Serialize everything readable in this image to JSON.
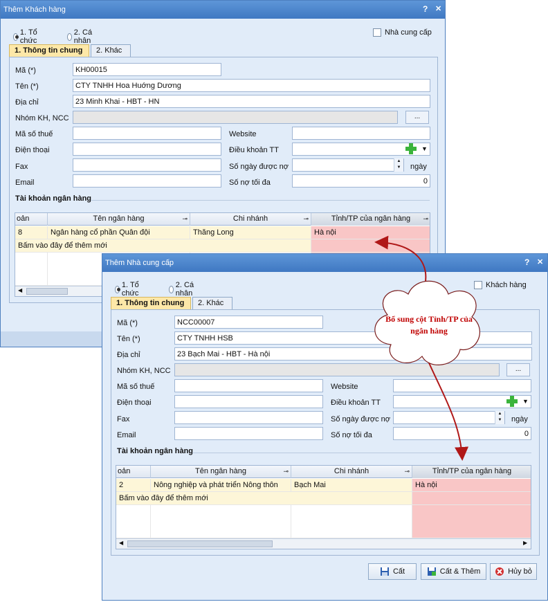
{
  "win1": {
    "title": "Thêm Khách hàng",
    "help": "?",
    "close": "✕",
    "radio_org": "1. Tổ chức",
    "radio_person": "2. Cá nhân",
    "check_label": "Nhà cung cấp",
    "tab_general": "1. Thông tin chung",
    "tab_other": "2. Khác",
    "labels": {
      "ma": "Mã (*)",
      "ten": "Tên (*)",
      "diachi": "Địa chỉ",
      "nhom": "Nhóm KH, NCC",
      "mst": "Mã số thuế",
      "dt": "Điện thoại",
      "fax": "Fax",
      "email": "Email",
      "web": "Website",
      "dktt": "Điều khoản TT",
      "sndn": "Số ngày được nợ",
      "sntd": "Số nợ tối đa",
      "ngay": "ngày"
    },
    "values": {
      "ma": "KH00015",
      "ten": "CTY TNHH Hoa Huớng Dương",
      "diachi": "23 Minh Khai - HBT - HN",
      "sntd": "0",
      "dots": "..."
    },
    "bank_section": "Tài khoản ngân hàng",
    "grid": {
      "headers": [
        "oản",
        "Tên ngân hàng",
        "Chi nhánh",
        "Tỉnh/TP của ngân hàng"
      ],
      "row": [
        "8",
        "Ngân hàng cổ phần Quân đội",
        "Thăng Long",
        "Hà nội"
      ],
      "add_row": "Bấm vào đây để thêm mới"
    }
  },
  "win2": {
    "title": "Thêm Nhà cung cấp",
    "help": "?",
    "close": "✕",
    "radio_org": "1. Tổ chức",
    "radio_person": "2. Cá nhân",
    "check_label": "Khách hàng",
    "tab_general": "1. Thông tin chung",
    "tab_other": "2. Khác",
    "labels": {
      "ma": "Mã (*)",
      "ten": "Tên (*)",
      "diachi": "Địa chỉ",
      "nhom": "Nhóm KH, NCC",
      "mst": "Mã số thuế",
      "dt": "Điện thoại",
      "fax": "Fax",
      "email": "Email",
      "web": "Website",
      "dktt": "Điều khoản TT",
      "sndn": "Số ngày được nợ",
      "sntd": "Số nợ tối đa",
      "ngay": "ngày"
    },
    "values": {
      "ma": "NCC00007",
      "ten": "CTY TNHH HSB",
      "diachi": "23 Bạch Mai - HBT - Hà nội",
      "sntd": "0",
      "dots": "..."
    },
    "bank_section": "Tài khoản ngân hàng",
    "grid": {
      "headers": [
        "oản",
        "Tên ngân hàng",
        "Chi nhánh",
        "Tỉnh/TP của ngân hàng"
      ],
      "row": [
        "2",
        "Nông nghiệp và phát triển Nông thôn",
        "Bạch Mai",
        "Hà nội"
      ],
      "add_row": "Bấm vào đây để thêm mới"
    },
    "buttons": {
      "save": "Cất",
      "save_new": "Cất & Thêm",
      "cancel": "Hủy bỏ"
    }
  },
  "callout": "Bổ sung cột Tỉnh/TP của ngân hàng",
  "colors": {
    "title_bar": "#3f78c2",
    "window_bg": "#e1ecf9",
    "active_tab": "#fde8a8",
    "highlight_column": "#f9c6c6",
    "arrow": "#b01818",
    "callout_text": "#c00000"
  }
}
